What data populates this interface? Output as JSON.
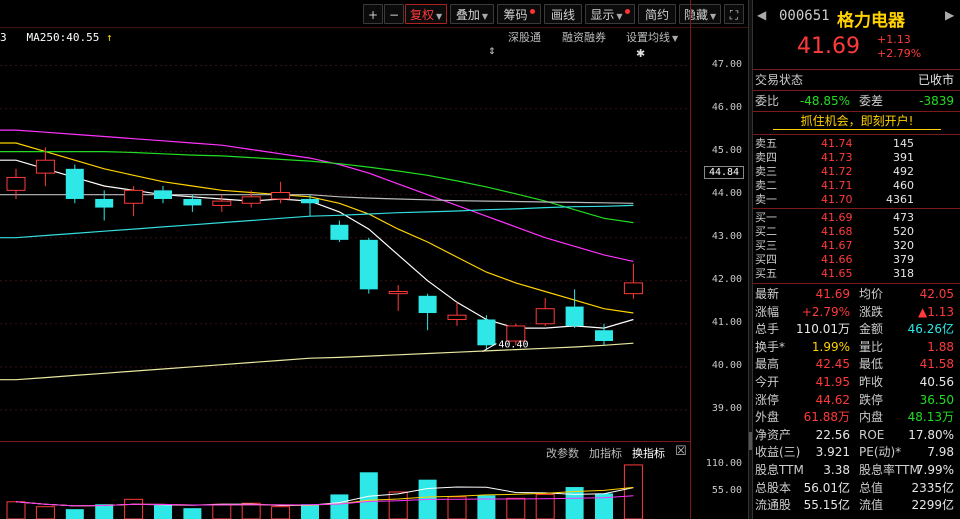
{
  "toolbar": {
    "zoom_in": "+",
    "zoom_out": "−",
    "adjust": "复权",
    "overlay": "叠加",
    "chips": "筹码",
    "draw": "画线",
    "display": "显示",
    "simple": "简约",
    "hide": "隐藏",
    "fullscreen": "⛶"
  },
  "ma_legend": {
    "prefix": "3",
    "label": "MA250:40.55",
    "arrow": "↑"
  },
  "chart_top_buttons": {
    "hk_connect": "深股通",
    "margin": "融资融券",
    "ma_settings": "设置均线"
  },
  "price_axis": [
    {
      "label": "47.00",
      "value": 47.0
    },
    {
      "label": "46.00",
      "value": 46.0
    },
    {
      "label": "45.00",
      "value": 45.0
    },
    {
      "label": "44.00",
      "value": 44.0
    },
    {
      "label": "43.00",
      "value": 43.0
    },
    {
      "label": "42.00",
      "value": 42.0
    },
    {
      "label": "41.00",
      "value": 41.0
    },
    {
      "label": "40.00",
      "value": 40.0
    },
    {
      "label": "39.00",
      "value": 39.0
    }
  ],
  "current_price_tag": "44.84",
  "low_marker": "40.40",
  "indicator_bar": {
    "params": "改参数",
    "add": "加指标",
    "swap": "换指标",
    "close": "☒"
  },
  "volume_axis": [
    {
      "label": "110.00",
      "value": 110
    },
    {
      "label": "55.00",
      "value": 55
    }
  ],
  "chart_data": {
    "type": "candlestick",
    "ylim": [
      38.3,
      47.5
    ],
    "candles": [
      {
        "o": 44.1,
        "c": 44.4,
        "h": 44.6,
        "l": 43.9
      },
      {
        "o": 44.5,
        "c": 44.8,
        "h": 45.1,
        "l": 44.2
      },
      {
        "o": 44.6,
        "c": 43.9,
        "h": 44.7,
        "l": 43.8
      },
      {
        "o": 43.9,
        "c": 43.7,
        "h": 44.1,
        "l": 43.4
      },
      {
        "o": 43.8,
        "c": 44.1,
        "h": 44.2,
        "l": 43.5
      },
      {
        "o": 44.1,
        "c": 43.9,
        "h": 44.2,
        "l": 43.8
      },
      {
        "o": 43.9,
        "c": 43.75,
        "h": 44.0,
        "l": 43.6
      },
      {
        "o": 43.75,
        "c": 43.85,
        "h": 44.0,
        "l": 43.6
      },
      {
        "o": 43.8,
        "c": 43.95,
        "h": 44.1,
        "l": 43.7
      },
      {
        "o": 43.9,
        "c": 44.05,
        "h": 44.3,
        "l": 43.8
      },
      {
        "o": 43.9,
        "c": 43.8,
        "h": 44.0,
        "l": 43.5
      },
      {
        "o": 43.3,
        "c": 42.95,
        "h": 43.4,
        "l": 42.9
      },
      {
        "o": 42.95,
        "c": 41.8,
        "h": 43.0,
        "l": 41.7
      },
      {
        "o": 41.7,
        "c": 41.75,
        "h": 41.9,
        "l": 41.3
      },
      {
        "o": 41.65,
        "c": 41.25,
        "h": 41.7,
        "l": 40.85
      },
      {
        "o": 41.1,
        "c": 41.2,
        "h": 41.5,
        "l": 40.95
      },
      {
        "o": 41.1,
        "c": 40.5,
        "h": 41.2,
        "l": 40.4
      },
      {
        "o": 40.6,
        "c": 40.95,
        "h": 41.0,
        "l": 40.5
      },
      {
        "o": 41.0,
        "c": 41.35,
        "h": 41.6,
        "l": 40.95
      },
      {
        "o": 41.4,
        "c": 40.95,
        "h": 41.8,
        "l": 40.9
      },
      {
        "o": 40.85,
        "c": 40.6,
        "h": 41.0,
        "l": 40.5
      },
      {
        "o": 41.7,
        "c": 41.95,
        "h": 42.4,
        "l": 41.58
      }
    ],
    "ma_lines": [
      {
        "color": "#ffffff",
        "values": [
          44.8,
          44.6,
          44.4,
          44.2,
          44.1,
          44.0,
          43.95,
          43.9,
          43.85,
          43.9,
          43.85,
          43.6,
          43.2,
          42.6,
          42.0,
          41.5,
          41.1,
          40.9,
          40.9,
          40.95,
          40.9,
          41.1
        ]
      },
      {
        "color": "#ffd200",
        "values": [
          45.2,
          45.0,
          44.8,
          44.6,
          44.45,
          44.3,
          44.2,
          44.1,
          44.05,
          44.0,
          43.95,
          43.8,
          43.55,
          43.2,
          42.9,
          42.55,
          42.2,
          41.95,
          41.75,
          41.55,
          41.35,
          41.25
        ]
      },
      {
        "color": "#ff33ff",
        "values": [
          45.5,
          45.45,
          45.4,
          45.35,
          45.3,
          45.25,
          45.2,
          45.15,
          45.05,
          44.95,
          44.85,
          44.7,
          44.5,
          44.25,
          44.0,
          43.75,
          43.5,
          43.25,
          43.0,
          42.8,
          42.6,
          42.45
        ]
      },
      {
        "color": "#22dd22",
        "values": [
          45.0,
          45.0,
          45.0,
          45.0,
          44.98,
          44.95,
          44.92,
          44.9,
          44.86,
          44.82,
          44.78,
          44.72,
          44.64,
          44.55,
          44.45,
          44.32,
          44.18,
          44.02,
          43.85,
          43.65,
          43.45,
          43.35
        ]
      },
      {
        "color": "#bbbbbb",
        "values": [
          44.0,
          44.0,
          44.0,
          44.0,
          44.0,
          44.0,
          44.0,
          44.0,
          44.0,
          44.0,
          44.0,
          43.95,
          43.92,
          43.9,
          43.88,
          43.86,
          43.85,
          43.84,
          43.83,
          43.82,
          43.81,
          43.8
        ]
      },
      {
        "color": "#33dddd",
        "values": [
          43.0,
          43.05,
          43.1,
          43.15,
          43.2,
          43.25,
          43.3,
          43.35,
          43.4,
          43.45,
          43.5,
          43.52,
          43.55,
          43.58,
          43.6,
          43.62,
          43.65,
          43.67,
          43.7,
          43.72,
          43.73,
          43.75
        ]
      },
      {
        "color": "#e8e8a0",
        "values": [
          39.7,
          39.75,
          39.8,
          39.85,
          39.9,
          39.95,
          40.0,
          40.05,
          40.1,
          40.15,
          40.2,
          40.22,
          40.25,
          40.28,
          40.31,
          40.34,
          40.37,
          40.4,
          40.43,
          40.46,
          40.5,
          40.55
        ]
      }
    ],
    "volume": {
      "ylim": [
        0,
        120
      ],
      "values": [
        35,
        25,
        20,
        30,
        40,
        28,
        22,
        30,
        32,
        25,
        30,
        50,
        95,
        55,
        80,
        45,
        48,
        42,
        50,
        65,
        52,
        110
      ],
      "up": [
        true,
        true,
        false,
        false,
        true,
        false,
        false,
        true,
        true,
        true,
        false,
        false,
        false,
        true,
        false,
        true,
        false,
        true,
        true,
        false,
        false,
        true
      ]
    }
  },
  "panel": {
    "nav_prev": "◀",
    "nav_next": "▶",
    "code": "000651",
    "name": "格力电器",
    "price": "41.69",
    "change": "+1.13",
    "change_pct": "+2.79%",
    "trade_status_label": "交易状态",
    "trade_status_value": "已收市",
    "weibi_label": "委比",
    "weibi_value": "-48.85%",
    "weicha_label": "委差",
    "weicha_value": "-3839",
    "banner": "抓住机会，即刻开户!",
    "asks": [
      {
        "label": "卖五",
        "price": "41.74",
        "vol": "145"
      },
      {
        "label": "卖四",
        "price": "41.73",
        "vol": "391"
      },
      {
        "label": "卖三",
        "price": "41.72",
        "vol": "492"
      },
      {
        "label": "卖二",
        "price": "41.71",
        "vol": "460"
      },
      {
        "label": "卖一",
        "price": "41.70",
        "vol": "4361"
      }
    ],
    "bids": [
      {
        "label": "买一",
        "price": "41.69",
        "vol": "473"
      },
      {
        "label": "买二",
        "price": "41.68",
        "vol": "520"
      },
      {
        "label": "买三",
        "price": "41.67",
        "vol": "320"
      },
      {
        "label": "买四",
        "price": "41.66",
        "vol": "379"
      },
      {
        "label": "买五",
        "price": "41.65",
        "vol": "318"
      }
    ],
    "stats": [
      {
        "l1": "最新",
        "v1": "41.69",
        "c1": "red",
        "l2": "均价",
        "v2": "42.05",
        "c2": "red"
      },
      {
        "l1": "涨幅",
        "v1": "+2.79%",
        "c1": "red",
        "l2": "涨跌",
        "v2": "▲1.13",
        "c2": "red"
      },
      {
        "l1": "总手",
        "v1": "110.01万",
        "c1": "white",
        "l2": "金额",
        "v2": "46.26亿",
        "c2": "cyan"
      },
      {
        "l1": "换手*",
        "v1": "1.99%",
        "c1": "yellow",
        "l2": "量比",
        "v2": "1.88",
        "c2": "red"
      },
      {
        "l1": "最高",
        "v1": "42.45",
        "c1": "red",
        "l2": "最低",
        "v2": "41.58",
        "c2": "red"
      },
      {
        "l1": "今开",
        "v1": "41.95",
        "c1": "red",
        "l2": "昨收",
        "v2": "40.56",
        "c2": "white"
      },
      {
        "l1": "涨停",
        "v1": "44.62",
        "c1": "red",
        "l2": "跌停",
        "v2": "36.50",
        "c2": "green"
      },
      {
        "l1": "外盘",
        "v1": "61.88万",
        "c1": "red",
        "l2": "内盘",
        "v2": "48.13万",
        "c2": "green"
      },
      {
        "l1": "净资产",
        "v1": "22.56",
        "c1": "white",
        "l2": "ROE",
        "v2": "17.80%",
        "c2": "white"
      },
      {
        "l1": "收益(三)",
        "v1": "3.921",
        "c1": "white",
        "l2": "PE(动)*",
        "v2": "7.98",
        "c2": "white"
      },
      {
        "l1": "股息TTM",
        "v1": "3.38",
        "c1": "white",
        "l2": "股息率TTM",
        "v2": "7.99%",
        "c2": "white"
      },
      {
        "l1": "总股本",
        "v1": "56.01亿",
        "c1": "white",
        "l2": "总值",
        "v2": "2335亿",
        "c2": "white"
      },
      {
        "l1": "流通股",
        "v1": "55.15亿",
        "c1": "white",
        "l2": "流值",
        "v2": "2299亿",
        "c2": "white"
      }
    ]
  }
}
